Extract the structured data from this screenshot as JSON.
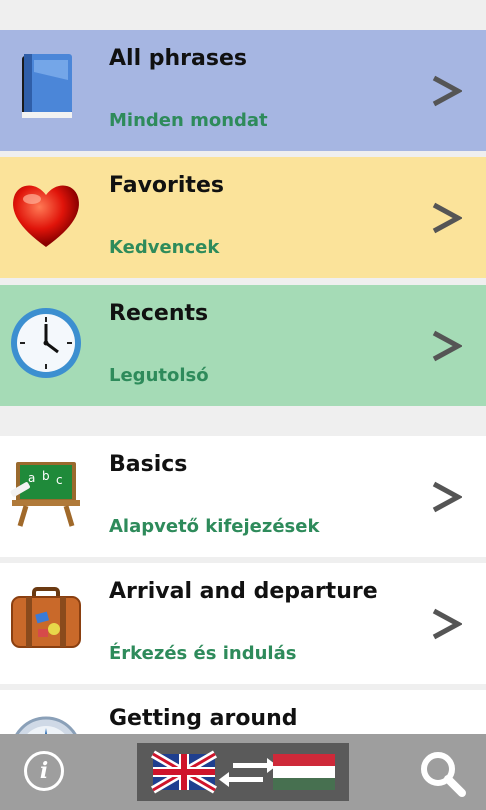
{
  "rows": [
    {
      "title": "All phrases",
      "subtitle": "Minden mondat",
      "icon": "book-icon",
      "bg": "#a6b6e2"
    },
    {
      "title": "Favorites",
      "subtitle": "Kedvencek",
      "icon": "heart-icon",
      "bg": "#fbe39a"
    },
    {
      "title": "Recents",
      "subtitle": "Legutolsó",
      "icon": "clock-icon",
      "bg": "#a5dbb6"
    },
    {
      "title": "Basics",
      "subtitle": "Alapvető kifejezések",
      "icon": "chalkboard-icon",
      "bg": "#ffffff"
    },
    {
      "title": "Arrival and departure",
      "subtitle": "Érkezés és indulás",
      "icon": "suitcase-icon",
      "bg": "#ffffff"
    },
    {
      "title": "Getting around",
      "subtitle": "",
      "icon": "compass-icon",
      "bg": "#ffffff"
    }
  ],
  "bottombar": {
    "info_label": "i",
    "from_flag": "uk-flag-icon",
    "to_flag": "hungary-flag-icon",
    "swap_icon": "swap-arrows-icon",
    "search_icon": "search-icon"
  },
  "colors": {
    "subtitle": "#2e8b5b",
    "chevron": "#555555",
    "bar": "#9e9e9e"
  }
}
